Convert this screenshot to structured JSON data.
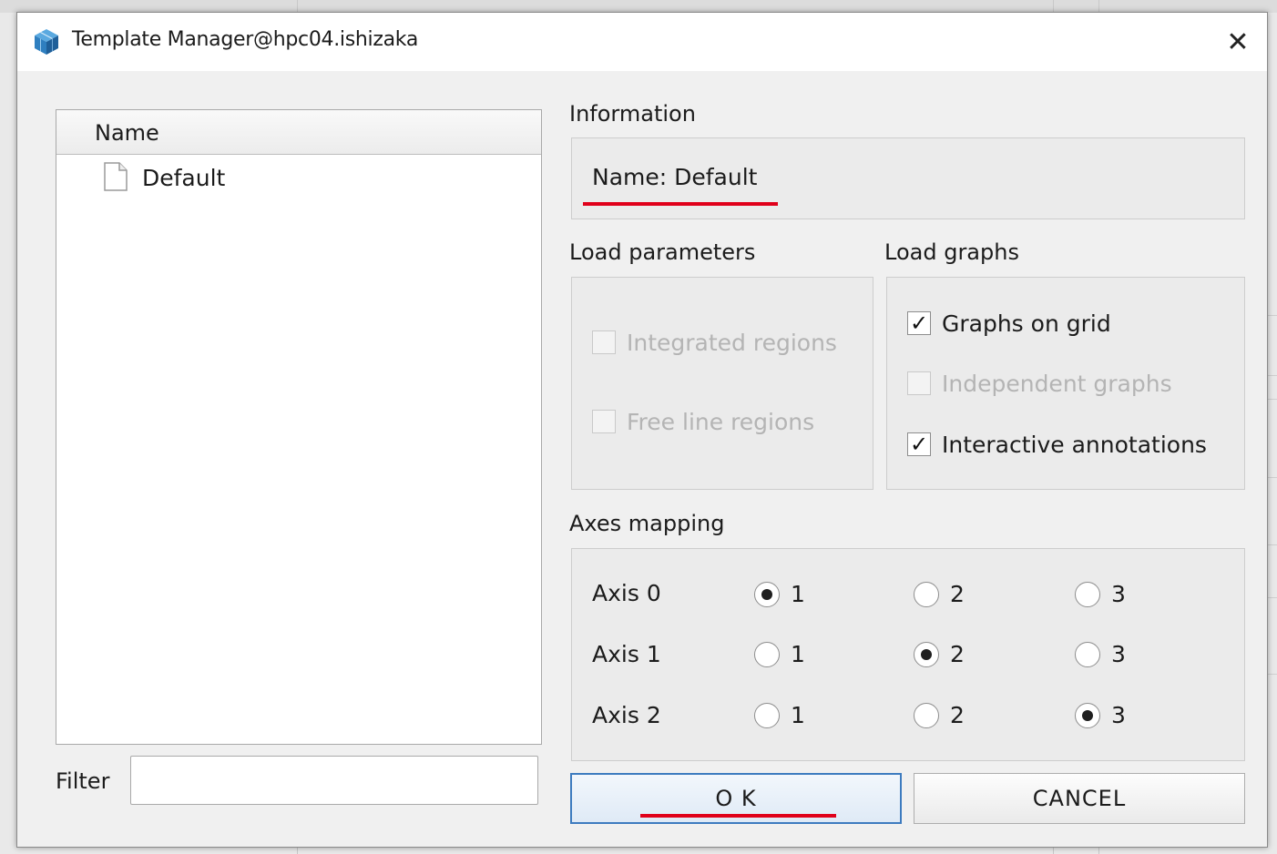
{
  "window": {
    "title": "Template Manager@hpc04.ishizaka",
    "close_glyph": "✕",
    "app_icon": "cube-icon"
  },
  "template_list": {
    "column_header": "Name",
    "items": [
      {
        "label": "Default",
        "icon": "file-icon"
      }
    ],
    "filter_label": "Filter",
    "filter_value": ""
  },
  "information": {
    "section_label": "Information",
    "name_text": "Name: Default"
  },
  "load_parameters": {
    "section_label": "Load parameters",
    "options": [
      {
        "label": "Integrated regions",
        "checked": false,
        "enabled": false
      },
      {
        "label": "Free line regions",
        "checked": false,
        "enabled": false
      }
    ]
  },
  "load_graphs": {
    "section_label": "Load graphs",
    "options": [
      {
        "label": "Graphs on grid",
        "checked": true,
        "enabled": true
      },
      {
        "label": "Independent graphs",
        "checked": false,
        "enabled": false
      },
      {
        "label": "Interactive annotations",
        "checked": true,
        "enabled": true
      }
    ]
  },
  "axes_mapping": {
    "section_label": "Axes mapping",
    "rows": [
      {
        "label": "Axis 0",
        "choices": [
          "1",
          "2",
          "3"
        ],
        "selected": "1"
      },
      {
        "label": "Axis 1",
        "choices": [
          "1",
          "2",
          "3"
        ],
        "selected": "2"
      },
      {
        "label": "Axis 2",
        "choices": [
          "1",
          "2",
          "3"
        ],
        "selected": "3"
      }
    ]
  },
  "buttons": {
    "ok_label": "O K",
    "cancel_label": "CANCEL"
  },
  "colors": {
    "annotation_underline": "#e0001a",
    "primary_button_border": "#3d7bbf",
    "disabled_text": "#b4b4b4"
  },
  "checkmark_glyph": "✓"
}
